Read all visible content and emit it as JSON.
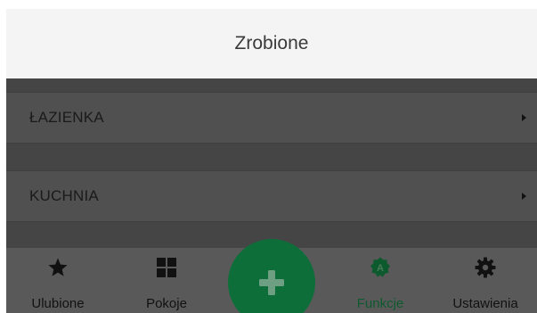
{
  "header": {
    "title": "Zrobione"
  },
  "list": {
    "items": [
      {
        "label": "ŁAZIENKA",
        "icon": "chevron-right-icon"
      },
      {
        "label": "KUCHNIA",
        "icon": "chevron-right-icon"
      }
    ]
  },
  "tabbar": {
    "tabs": [
      {
        "label": "Ulubione",
        "icon": "star-icon"
      },
      {
        "label": "Pokoje",
        "icon": "grid-icon"
      },
      {
        "label": "Funkcje",
        "icon": "functions-badge-icon",
        "badge": "A",
        "active": true
      },
      {
        "label": "Ustawienia",
        "icon": "gear-icon"
      }
    ],
    "fab": {
      "icon": "plus-icon"
    }
  },
  "colors": {
    "header_bg": "#f4f4f4",
    "overlay_bg": "#4b4b4b",
    "tabbar_bg": "#595959",
    "accent": "#0e6e3a",
    "active_tab": "#0d5a2e"
  }
}
